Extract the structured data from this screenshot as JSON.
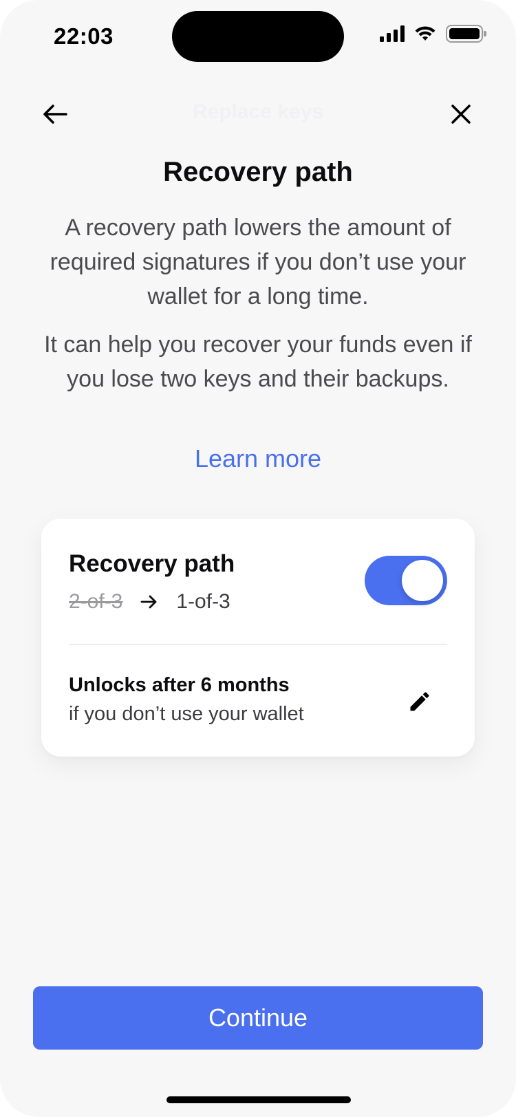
{
  "status_bar": {
    "time": "22:03"
  },
  "nav": {
    "title": "Replace keys",
    "back_icon": "arrow-left-icon",
    "close_icon": "close-icon"
  },
  "main": {
    "title": "Recovery path",
    "description_1": "A recovery path lowers the amount of required signatures if you don’t use your wallet for a long time.",
    "description_2": "It can help you recover your funds even if you lose two keys and their backups.",
    "learn_more": "Learn more"
  },
  "card": {
    "title": "Recovery path",
    "old_scheme": "2-of-3",
    "new_scheme": "1-of-3",
    "toggle_on": true,
    "unlock_title": "Unlocks after 6 months",
    "unlock_subtitle": "if you don’t use your wallet",
    "edit_icon": "pencil-icon"
  },
  "footer": {
    "continue_label": "Continue"
  },
  "colors": {
    "accent": "#4a6fef",
    "background": "#f7f7f8",
    "card": "#ffffff"
  }
}
